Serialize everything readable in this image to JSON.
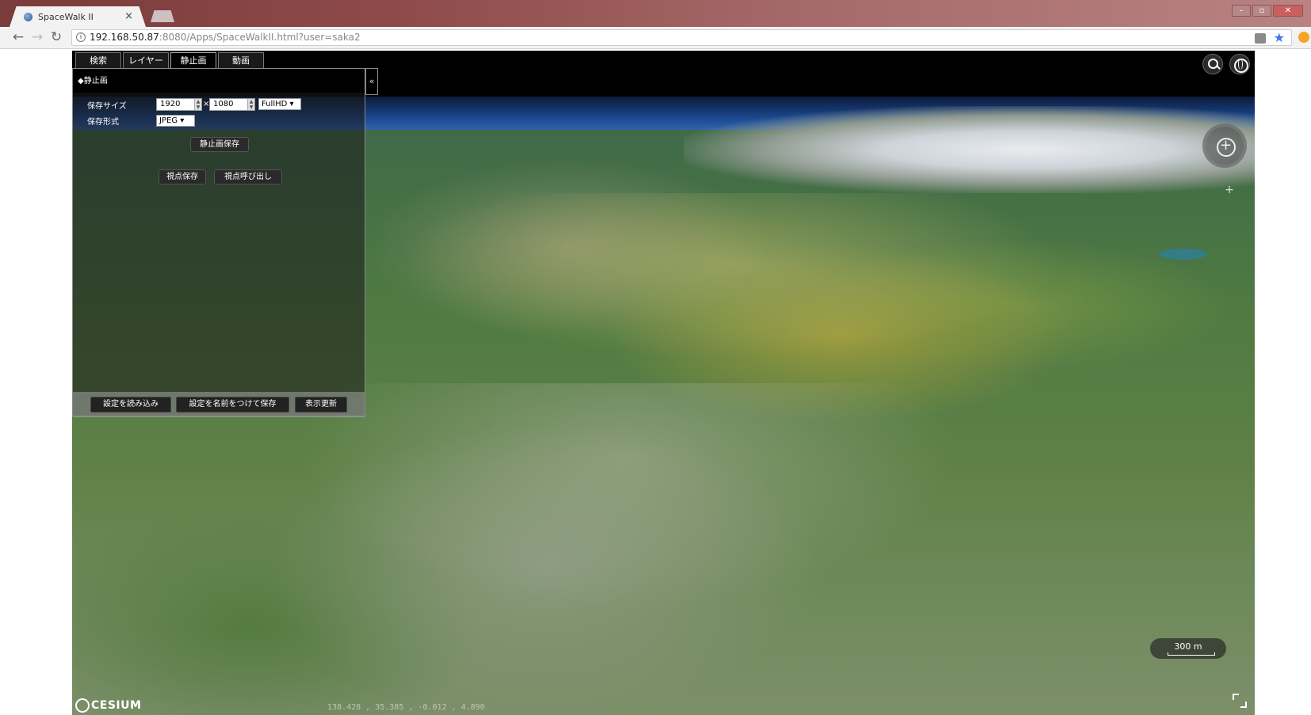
{
  "browser": {
    "tab_title": "SpaceWalk II",
    "tab_close": "×",
    "url_host": "192.168.50.87",
    "url_rest": ":8080/Apps/SpaceWalkII.html?user=saka2"
  },
  "panel": {
    "tabs": [
      "検索",
      "レイヤー",
      "静止画",
      "動画"
    ],
    "active_tab": "静止画",
    "collapse_label": "«",
    "section_title": "◆静止画",
    "save_size_label": "保存サイズ",
    "width_value": "1920",
    "times": "×",
    "height_value": "1080",
    "size_preset": "FullHD ▾",
    "format_label": "保存形式",
    "format_value": "JPEG ▾",
    "save_image_button": "静止画保存",
    "save_view_button": "視点保存",
    "load_view_button": "視点呼び出し",
    "footer": {
      "load_settings": "設定を読み込み",
      "save_settings_as": "設定を名前をつけて保存",
      "refresh": "表示更新"
    }
  },
  "map": {
    "scale": "300 m",
    "logo": "CESIUM",
    "coords": "138.428 , 35.385 , -0.012 , 4.890"
  }
}
